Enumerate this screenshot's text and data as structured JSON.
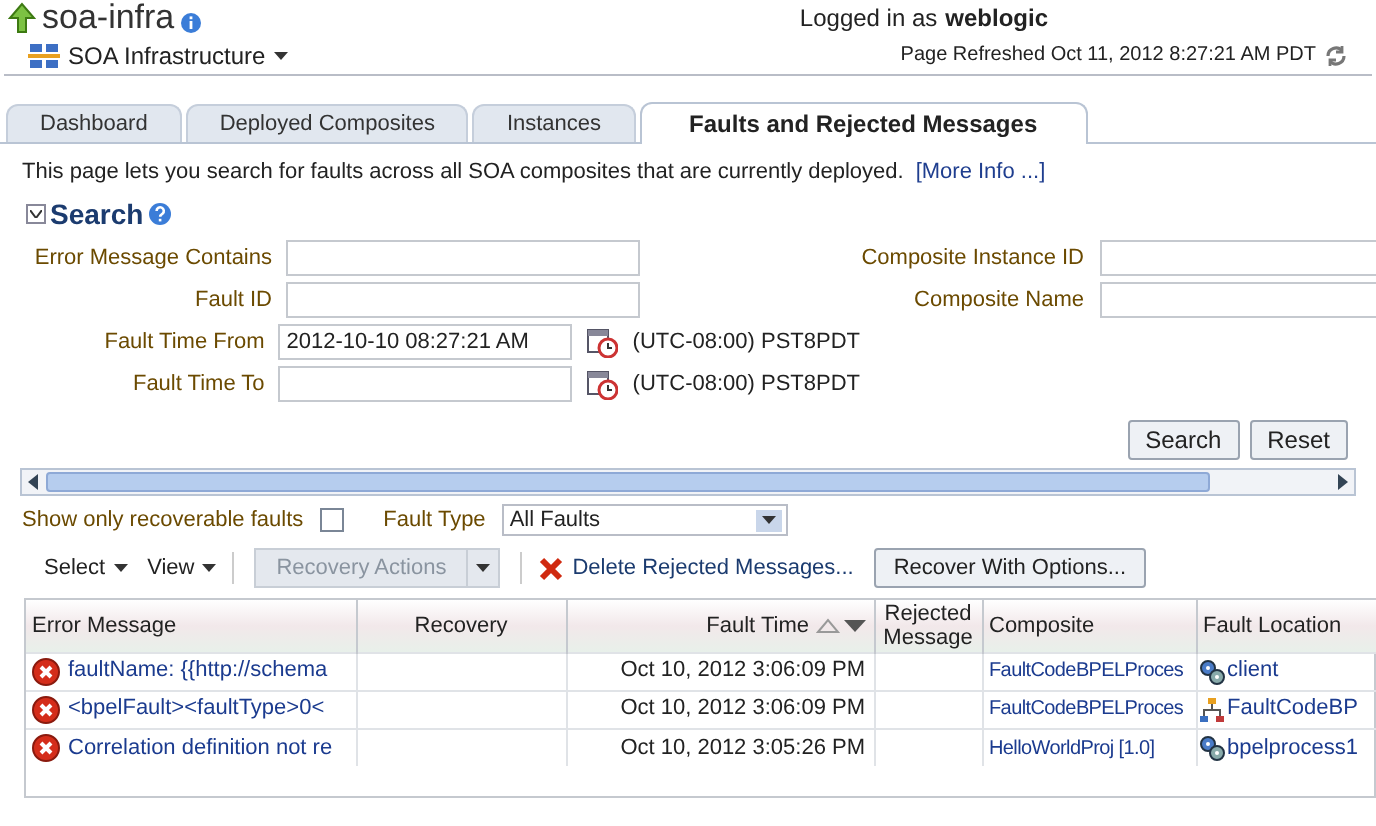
{
  "header": {
    "title": "soa-infra",
    "logged_in_label": "Logged in as",
    "user": "weblogic",
    "target_menu": "SOA Infrastructure",
    "refreshed": "Page Refreshed Oct 11, 2012 8:27:21 AM PDT"
  },
  "tabs": [
    {
      "label": "Dashboard",
      "selected": false
    },
    {
      "label": "Deployed Composites",
      "selected": false
    },
    {
      "label": "Instances",
      "selected": false
    },
    {
      "label": "Faults and Rejected Messages",
      "selected": true
    }
  ],
  "intro": {
    "text": "This page lets you search for faults across all SOA composites that are currently deployed.",
    "link": "[More Info ...]"
  },
  "search": {
    "title": "Search",
    "expanded": true,
    "left_fields": [
      {
        "label": "Error Message Contains",
        "kind": "text"
      },
      {
        "label": "Fault ID",
        "kind": "text"
      },
      {
        "label": "Fault Time From",
        "kind": "date",
        "value": "2012-10-10 08:27:21 AM",
        "timezone": "(UTC-08:00) PST8PDT"
      },
      {
        "label": "Fault Time To",
        "kind": "date",
        "timezone": "(UTC-08:00) PST8PDT"
      }
    ],
    "right_fields": [
      {
        "label": "Composite Instance ID"
      },
      {
        "label": "Composite Name"
      }
    ],
    "buttons": [
      "Search",
      "Reset"
    ]
  },
  "filters": {
    "recoverable_label": "Show only recoverable faults",
    "recoverable_checked": false,
    "fault_type_label": "Fault Type",
    "fault_type": "All Faults"
  },
  "toolbar": {
    "select": "Select",
    "view": "View",
    "recovery_actions": "Recovery Actions",
    "recovery_disabled": true,
    "delete": "Delete Rejected Messages...",
    "recover": "Recover With Options..."
  },
  "table": {
    "columns": [
      "Error Message",
      "Recovery",
      "Fault Time",
      "Rejected Message",
      "Composite",
      "Fault Location"
    ],
    "rows": [
      {
        "error": "faultName: {{http://schema",
        "time": "Oct 10, 2012 3:06:09 PM",
        "composite": "FaultCodeBPELProces",
        "location": "client",
        "kind": "service"
      },
      {
        "error": "<bpelFault><faultType>0<",
        "time": "Oct 10, 2012 3:06:09 PM",
        "composite": "FaultCodeBPELProces",
        "location": "FaultCodeBP",
        "kind": "process"
      },
      {
        "error": "Correlation definition not re",
        "time": "Oct 10, 2012 3:05:26 PM",
        "composite": "HelloWorldProj [1.0]",
        "location": "bpelprocess1",
        "kind": "service"
      }
    ]
  }
}
